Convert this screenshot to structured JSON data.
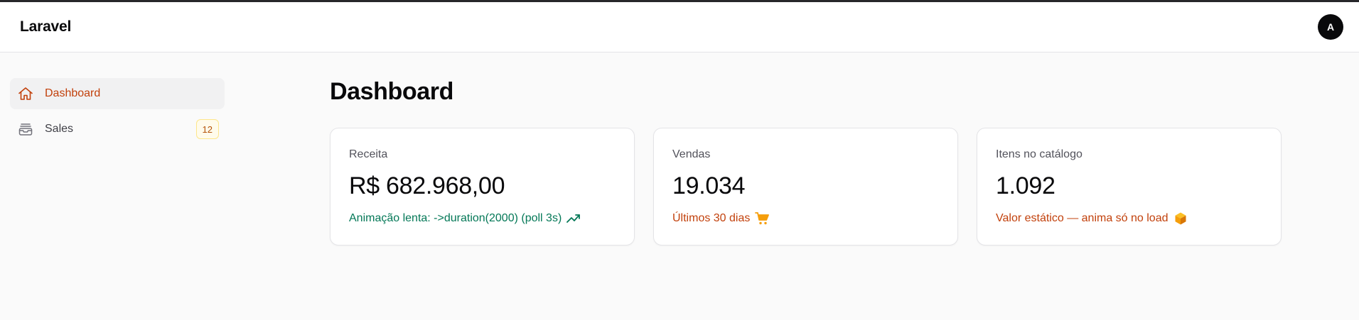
{
  "app": {
    "brand": "Laravel"
  },
  "user": {
    "avatar_initial": "A"
  },
  "sidebar": {
    "items": [
      {
        "label": "Dashboard",
        "icon": "home-icon",
        "active": true
      },
      {
        "label": "Sales",
        "icon": "inbox-icon",
        "badge": "12"
      }
    ]
  },
  "main": {
    "title": "Dashboard",
    "cards": [
      {
        "label": "Receita",
        "value": "R$ 682.968,00",
        "description": "Animação lenta: ->duration(2000) (poll 3s)",
        "icon": "trending-up-icon",
        "color": "#047857"
      },
      {
        "label": "Vendas",
        "value": "19.034",
        "description": "Últimos 30 dias",
        "icon": "cart-icon",
        "color": "#c2410c"
      },
      {
        "label": "Itens no catálogo",
        "value": "1.092",
        "description": "Valor estático — anima só no load",
        "icon": "cube-icon",
        "color": "#c2410c"
      }
    ]
  },
  "colors": {
    "accent": "#c2410c",
    "success": "#047857",
    "icon_amber": "#f59e0b"
  }
}
